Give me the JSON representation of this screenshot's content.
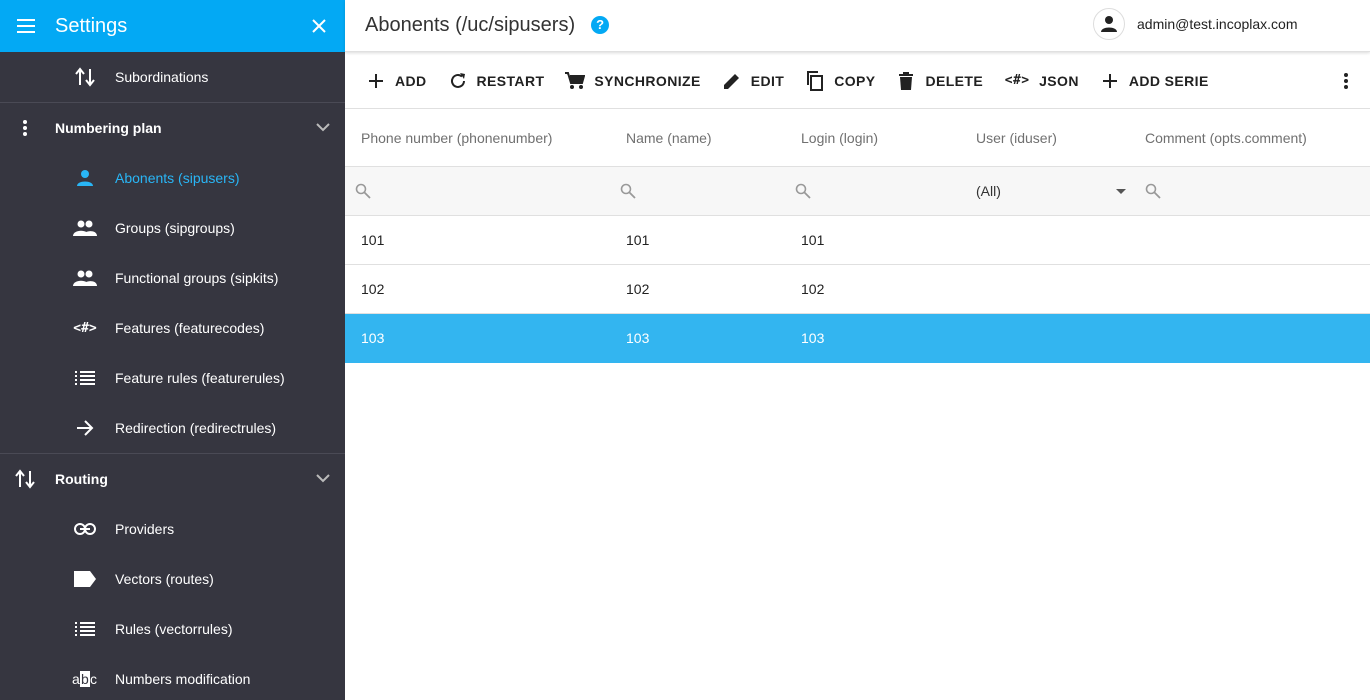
{
  "sidebar": {
    "title": "Settings",
    "items": [
      {
        "type": "item",
        "label": "Subordinations",
        "icon": "sort-arrows-icon",
        "active": false
      },
      {
        "type": "group",
        "label": "Numbering plan",
        "icon": "more-vertical-icon"
      },
      {
        "type": "item",
        "label": "Abonents (sipusers)",
        "icon": "person-icon",
        "active": true
      },
      {
        "type": "item",
        "label": "Groups (sipgroups)",
        "icon": "people-icon",
        "active": false
      },
      {
        "type": "item",
        "label": "Functional groups (sipkits)",
        "icon": "people-icon",
        "active": false
      },
      {
        "type": "item",
        "label": "Features (featurecodes)",
        "icon": "code-hash-icon",
        "active": false
      },
      {
        "type": "item",
        "label": "Feature rules (featurerules)",
        "icon": "list-icon",
        "active": false
      },
      {
        "type": "item",
        "label": "Redirection (redirectrules)",
        "icon": "arrow-right-icon",
        "active": false
      },
      {
        "type": "group",
        "label": "Routing",
        "icon": "sort-arrows-icon"
      },
      {
        "type": "item",
        "label": "Providers",
        "icon": "link-icon",
        "active": false
      },
      {
        "type": "item",
        "label": "Vectors (routes)",
        "icon": "label-icon",
        "active": false
      },
      {
        "type": "item",
        "label": "Rules (vectorrules)",
        "icon": "list-icon",
        "active": false
      },
      {
        "type": "item",
        "label": "Numbers modification",
        "icon": "abc-icon",
        "active": false
      }
    ]
  },
  "header": {
    "title": "Abonents (/uc/sipusers)",
    "help": "?",
    "user": "admin@test.incoplax.com"
  },
  "toolbar": {
    "buttons": [
      {
        "label": "ADD",
        "icon": "plus-icon"
      },
      {
        "label": "RESTART",
        "icon": "refresh-icon"
      },
      {
        "label": "SYNCHRONIZE",
        "icon": "cart-icon"
      },
      {
        "label": "EDIT",
        "icon": "pencil-icon"
      },
      {
        "label": "COPY",
        "icon": "copy-icon"
      },
      {
        "label": "DELETE",
        "icon": "trash-icon"
      },
      {
        "label": "JSON",
        "icon": "code-hash-icon"
      },
      {
        "label": "ADD SERIE",
        "icon": "plus-icon"
      }
    ]
  },
  "grid": {
    "columns": [
      "Phone number (phonenumber)",
      "Name (name)",
      "Login (login)",
      "User (iduser)",
      "Comment (opts.comment)"
    ],
    "user_filter_value": "(All)",
    "rows": [
      {
        "phone": "101",
        "name": "101",
        "login": "101",
        "user": "",
        "comment": ""
      },
      {
        "phone": "102",
        "name": "102",
        "login": "102",
        "user": "",
        "comment": ""
      },
      {
        "phone": "103",
        "name": "103",
        "login": "103",
        "user": "",
        "comment": ""
      }
    ],
    "selected_row": 2
  },
  "colors": {
    "sidebar_bg": "#363640",
    "accent": "#03a9f4",
    "selected_row": "#33b5f0",
    "active_item": "#29b6f6"
  }
}
